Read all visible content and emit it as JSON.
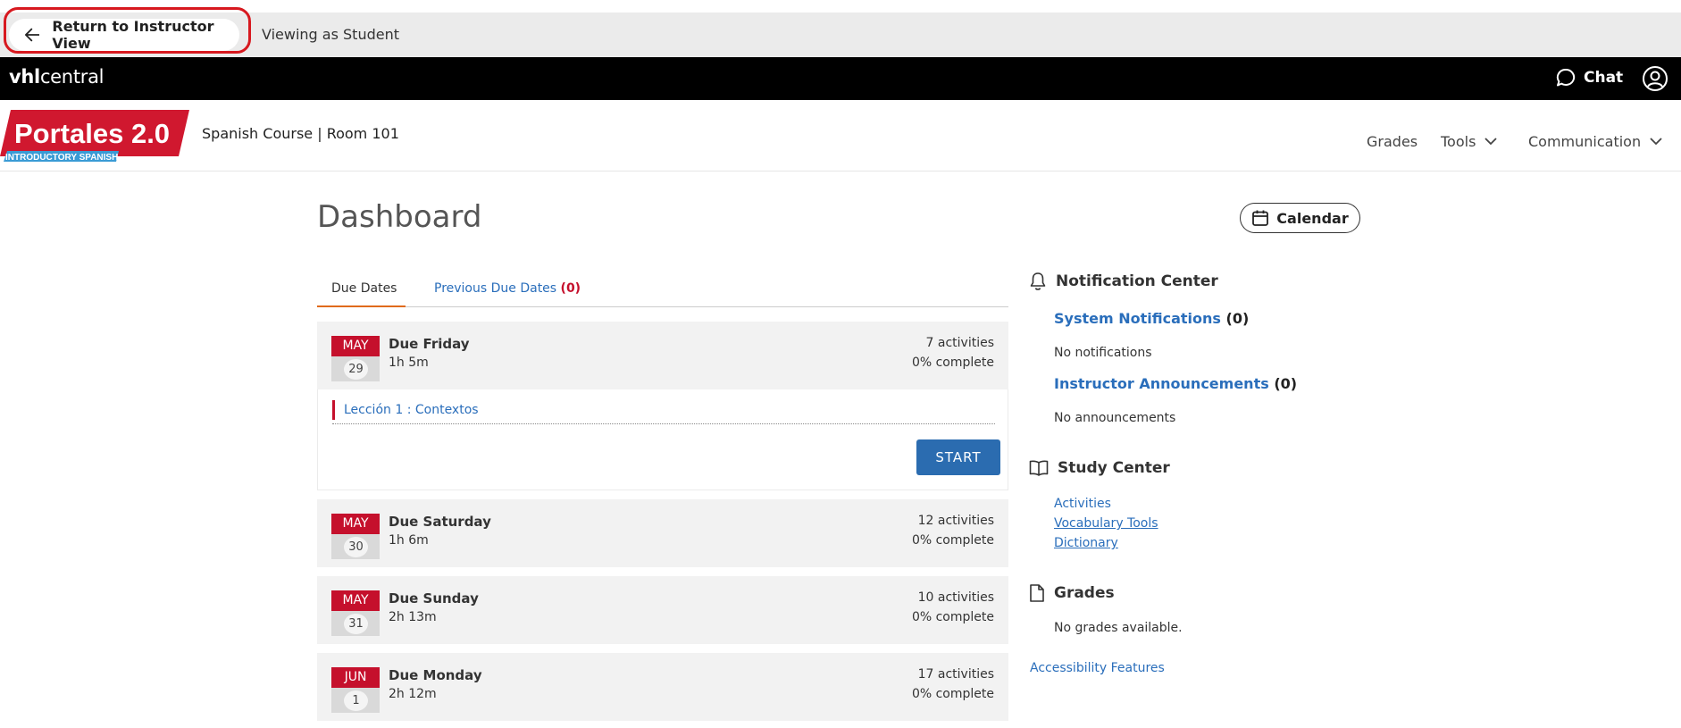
{
  "preview_bar": {
    "return_label": "Return to Instructor View",
    "viewing_as": "Viewing as Student"
  },
  "brand_bar": {
    "logo_bold": "vhl",
    "logo_rest": "central",
    "chat_label": "Chat"
  },
  "course": {
    "logo_title": "Portales 2.0",
    "logo_subtitle": "INTRODUCTORY SPANISH",
    "title": "Spanish Course | Room 101",
    "nav": {
      "grades": "Grades",
      "tools": "Tools",
      "communication": "Communication"
    }
  },
  "dashboard": {
    "title": "Dashboard",
    "calendar_label": "Calendar",
    "tabs": {
      "due_dates": "Due Dates",
      "previous_label": "Previous Due Dates",
      "previous_count": "(0)"
    },
    "due_items": [
      {
        "month": "MAY",
        "day": "29",
        "label": "Due Friday",
        "time": "1h 5m",
        "activities": "7 activities",
        "complete": "0% complete"
      },
      {
        "month": "MAY",
        "day": "30",
        "label": "Due Saturday",
        "time": "1h 6m",
        "activities": "12 activities",
        "complete": "0% complete"
      },
      {
        "month": "MAY",
        "day": "31",
        "label": "Due Sunday",
        "time": "2h 13m",
        "activities": "10 activities",
        "complete": "0% complete"
      },
      {
        "month": "JUN",
        "day": "1",
        "label": "Due Monday",
        "time": "2h 12m",
        "activities": "17 activities",
        "complete": "0% complete"
      }
    ],
    "expanded": {
      "lesson": "Lección 1 : Contextos",
      "start_label": "START"
    }
  },
  "sidebar": {
    "notification_center": "Notification Center",
    "system_notifications": "System Notifications",
    "system_count": "(0)",
    "no_notifications": "No notifications",
    "instructor_announcements": "Instructor Announcements",
    "announcements_count": "(0)",
    "no_announcements": "No announcements",
    "study_center": "Study Center",
    "study_links": [
      "Activities",
      "Vocabulary Tools",
      "Dictionary"
    ],
    "grades_heading": "Grades",
    "no_grades": "No grades available.",
    "accessibility": "Accessibility Features"
  },
  "colors": {
    "brand_red": "#c5102c",
    "link_blue": "#2a6ebb",
    "button_blue": "#2b6cb0",
    "tab_orange": "#e06a1c"
  }
}
